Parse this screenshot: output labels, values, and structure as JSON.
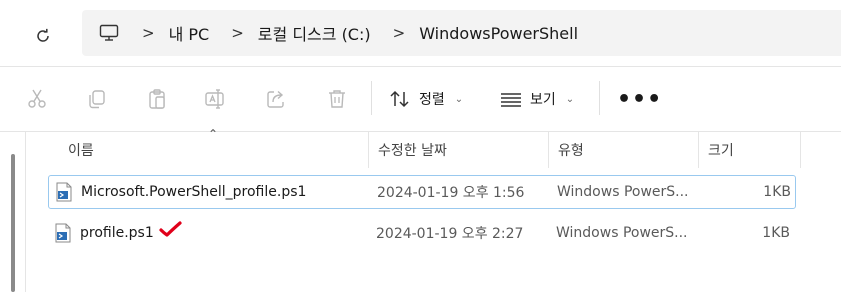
{
  "address": {
    "root_icon": "computer-icon",
    "crumbs": [
      "내 PC",
      "로컬 디스크 (C:)",
      "WindowsPowerShell"
    ]
  },
  "toolbar": {
    "cut_icon": "scissors-icon",
    "copy_icon": "copy-icon",
    "paste_icon": "clipboard-icon",
    "rename_icon": "rename-icon",
    "share_icon": "share-icon",
    "delete_icon": "trash-icon",
    "sort_label": "정렬",
    "view_label": "보기",
    "more_label": "•••"
  },
  "columns": {
    "name": "이름",
    "date": "수정한 날짜",
    "type": "유형",
    "size": "크기"
  },
  "files": [
    {
      "name": "Microsoft.PowerShell_profile.ps1",
      "date": "2024-01-19 오후 1:56",
      "type": "Windows PowerS...",
      "size": "1KB",
      "selected": true
    },
    {
      "name": "profile.ps1",
      "date": "2024-01-19 오후 2:27",
      "type": "Windows PowerS...",
      "size": "1KB",
      "selected": false
    }
  ],
  "colors": {
    "selection_border": "#99c9ef",
    "annotation_check": "#e0001a",
    "disabled_icon": "#b9b9b9"
  }
}
